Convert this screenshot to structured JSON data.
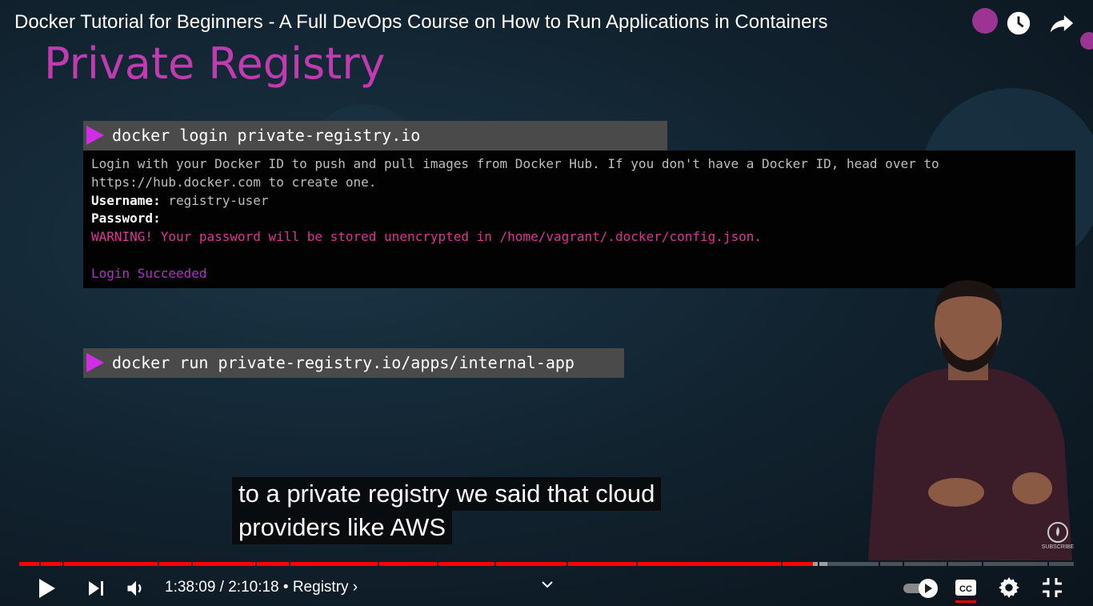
{
  "video": {
    "title": "Docker Tutorial for Beginners - A Full DevOps Course on How to Run Applications in Containers",
    "slide_title": "Private Registry",
    "commands": [
      "docker login private-registry.io",
      "docker run private-registry.io/apps/internal-app"
    ],
    "terminal": {
      "line1": "Login with your Docker ID to push and pull images from Docker Hub. If you don't have a Docker ID, head over to",
      "line2": "https://hub.docker.com to create one.",
      "username_label": "Username:",
      "username_value": " registry-user",
      "password_label": "Password:",
      "warning": "WARNING! Your password will be stored unencrypted in /home/vagrant/.docker/config.json.",
      "success": "Login Succeeded"
    },
    "captions": [
      "to a private registry we said that cloud",
      "providers like AWS"
    ],
    "subscribe_label": "SUBSCRIBE"
  },
  "player": {
    "current_time": "1:38:09",
    "duration": "2:10:18",
    "time_display": "1:38:09 / 2:10:18",
    "chapter": "• Registry ›",
    "progress_fraction": 0.753,
    "buffered_fraction": 0.766,
    "chapter_gaps": [
      0.019,
      0.041,
      0.131,
      0.163,
      0.224,
      0.256,
      0.34,
      0.396,
      0.451,
      0.519,
      0.585,
      0.722,
      0.757,
      0.815,
      0.838,
      0.879,
      0.913,
      0.975
    ],
    "captions_on": true,
    "accent_color": "#ff0000"
  }
}
